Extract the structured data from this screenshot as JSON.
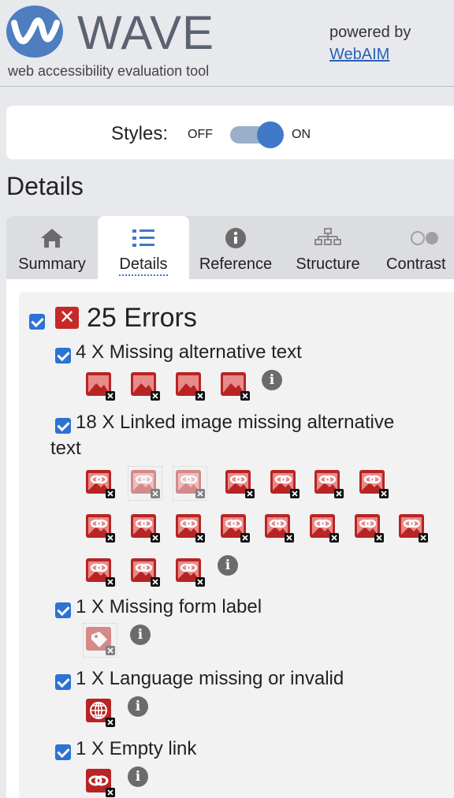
{
  "header": {
    "logo_text": "WAVE",
    "tagline": "web accessibility evaluation tool",
    "powered_by": "powered by",
    "webaim_link": "WebAIM"
  },
  "styles": {
    "label": "Styles:",
    "off": "OFF",
    "on": "ON",
    "enabled": true
  },
  "section_title": "Details",
  "tabs": [
    {
      "label": "Summary",
      "icon": "home-icon"
    },
    {
      "label": "Details",
      "icon": "list-icon",
      "active": true
    },
    {
      "label": "Reference",
      "icon": "info-icon"
    },
    {
      "label": "Structure",
      "icon": "structure-icon"
    },
    {
      "label": "Contrast",
      "icon": "contrast-icon"
    }
  ],
  "errors": {
    "title": "25 Errors",
    "categories": [
      {
        "label": "4 X Missing alternative text",
        "count": 4
      },
      {
        "label_line1": "18 X Linked image missing alternative",
        "label_line2": "text",
        "count": 18
      },
      {
        "label": "1 X Missing form label",
        "count": 1
      },
      {
        "label": "1 X Language missing or invalid",
        "count": 1
      },
      {
        "label": "1 X Empty link",
        "count": 1
      }
    ]
  },
  "colors": {
    "accent": "#2c73d2",
    "error": "#c72828",
    "icon_red": "#b82424"
  }
}
